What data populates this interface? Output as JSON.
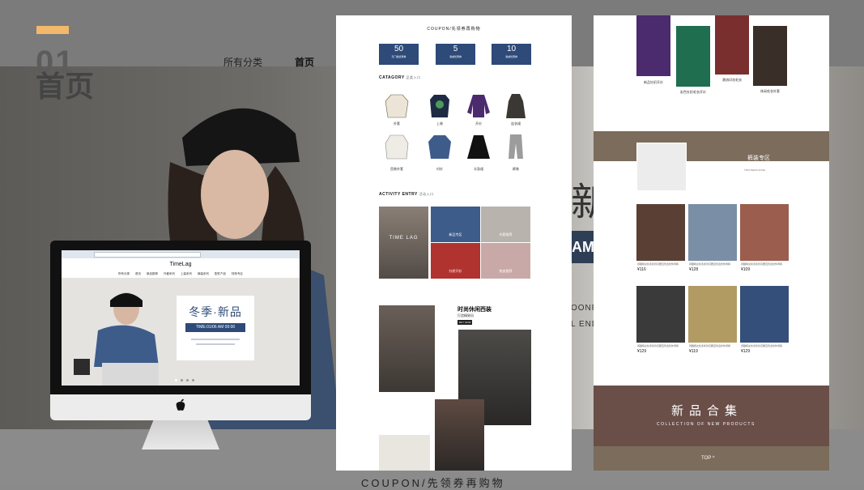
{
  "slide": {
    "number": "01",
    "title": "首页",
    "nav": [
      "所有分类",
      "首页"
    ],
    "ghost_char": "新",
    "ghost_am": "AM",
    "ghost_line1": "OONF I",
    "ghost_line2": "L END",
    "footer": "COUPON/先领券再购物"
  },
  "monitor": {
    "brand": "TimeLag",
    "nav": [
      "所有分类",
      "首页",
      "新品推荐",
      "外套系列",
      "上装系列",
      "裤装系列",
      "配件产品",
      "特别专区"
    ],
    "banner_title": "冬季·新品",
    "banner_time": "TIME:01/06 AM 00:00"
  },
  "page1": {
    "coupon_header": "COUPON/先领券再购物",
    "coupons": [
      {
        "value": "50",
        "desc": "无门槛优惠券"
      },
      {
        "value": "5",
        "desc": "满减优惠券"
      },
      {
        "value": "10",
        "desc": "满减优惠券"
      }
    ],
    "category_title": "CATAGORY",
    "category_sub": "品类入口",
    "categories": [
      "外套",
      "上装",
      "开衫",
      "连衣裙",
      "西装外套",
      "衬衫",
      "半身裙",
      "裤装"
    ],
    "activity_title": "ACTIVITY ENTRY",
    "activity_sub": "活动入口",
    "activity_brand": "TIME LAG",
    "activity_labels": [
      "新品专区",
      "外套推荐",
      "针织开衫",
      "热卖推荐"
    ],
    "feature_title": "时尚休闲西装",
    "feature_sub": "打造精致风",
    "feature_btn": "BUY NOW"
  },
  "page2": {
    "top_labels": [
      "新品针织开衫",
      "彩色针织毛衣开衫",
      "潮流印花毛衣",
      "休闲毛衣外套"
    ],
    "section_title": "裤装专区",
    "section_sub": "TROUSERS ZONE",
    "prices": [
      "¥116",
      "¥128",
      "¥109",
      "¥129",
      "¥119",
      "¥129"
    ],
    "product_desc": "阔腿裤女秋冬新款高腰直筒宽松休闲裤",
    "banner_title": "新品合集",
    "banner_sub": "COLLECTION OF NEW PRODUCTS",
    "top_button": "TOP"
  },
  "colors": {
    "accent": "#f2b86b",
    "navy": "#2d4a78",
    "brown": "#7b6c5b"
  }
}
